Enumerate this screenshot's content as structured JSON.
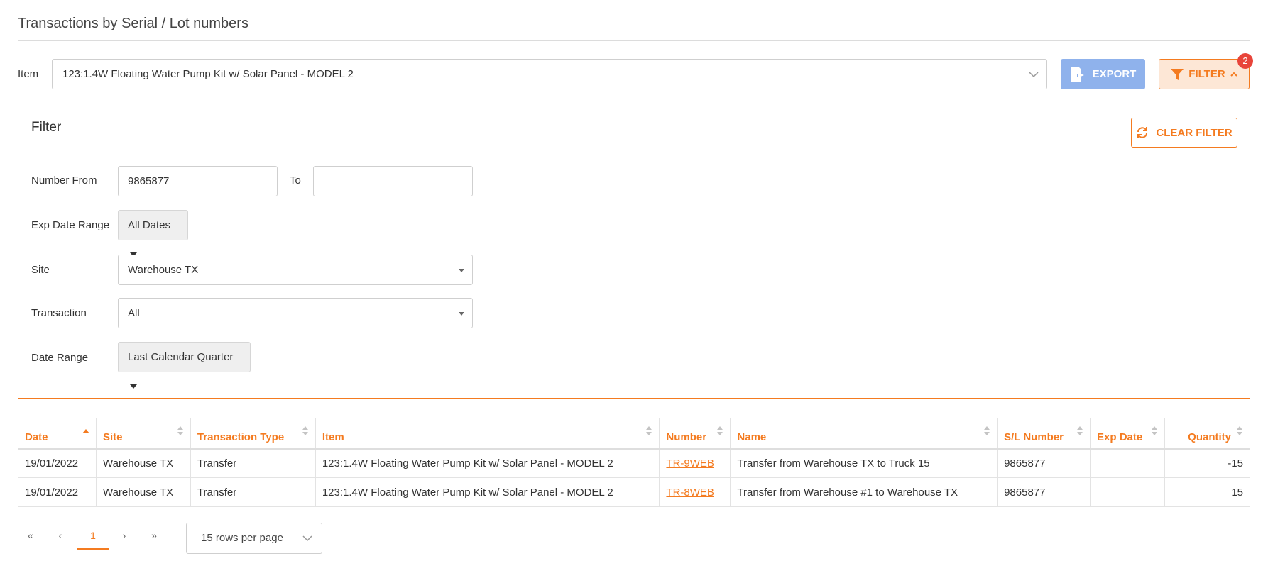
{
  "page": {
    "title": "Transactions by Serial / Lot numbers"
  },
  "toolbar": {
    "item_label": "Item",
    "item_value": "123:1.4W Floating Water Pump Kit w/ Solar Panel - MODEL 2",
    "export_label": "EXPORT",
    "filter_label": "FILTER",
    "filter_badge": "2"
  },
  "filter": {
    "title": "Filter",
    "clear_label": "CLEAR FILTER",
    "number_from_label": "Number From",
    "number_from_value": "9865877",
    "to_label": "To",
    "to_value": "",
    "exp_date_label": "Exp Date Range",
    "exp_date_value": "All Dates",
    "site_label": "Site",
    "site_value": "Warehouse TX",
    "transaction_label": "Transaction",
    "transaction_value": "All",
    "date_range_label": "Date Range",
    "date_range_value": "Last Calendar Quarter"
  },
  "table": {
    "columns": [
      "Date",
      "Site",
      "Transaction Type",
      "Item",
      "Number",
      "Name",
      "S/L Number",
      "Exp Date",
      "Quantity"
    ],
    "rows": [
      [
        "19/01/2022",
        "Warehouse TX",
        "Transfer",
        "123:1.4W Floating Water Pump Kit w/ Solar Panel - MODEL 2",
        "TR-9WEB",
        "Transfer from Warehouse TX to Truck 15",
        "9865877",
        "",
        "-15"
      ],
      [
        "19/01/2022",
        "Warehouse TX",
        "Transfer",
        "123:1.4W Floating Water Pump Kit w/ Solar Panel - MODEL 2",
        "TR-8WEB",
        "Transfer from Warehouse #1 to Warehouse TX",
        "9865877",
        "",
        "15"
      ]
    ]
  },
  "pagination": {
    "first": "«",
    "prev": "‹",
    "current": "1",
    "next": "›",
    "last": "»",
    "rows_per_page": "15 rows per page"
  },
  "colors": {
    "accent": "#f47b20",
    "export_bg": "#8fb2ec",
    "badge": "#e8443a"
  }
}
